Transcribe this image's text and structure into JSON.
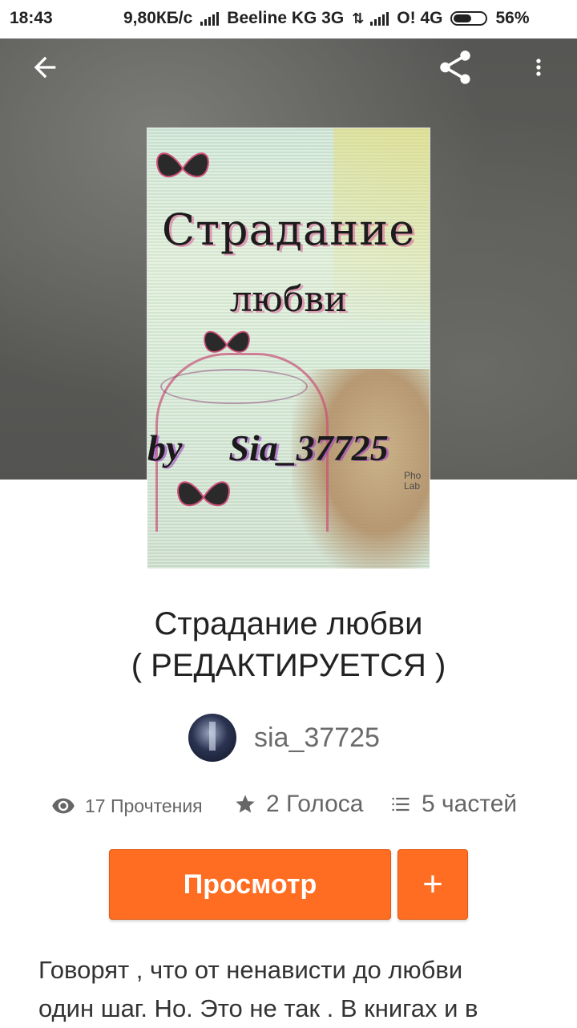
{
  "status_bar": {
    "time": "18:43",
    "network_speed": "9,80КБ/с",
    "carrier1": "Beeline KG 3G",
    "carrier2": "O! 4G",
    "battery": "56%"
  },
  "header": {
    "back_icon": "arrow-back-icon",
    "share_icon": "share-icon",
    "more_icon": "more-vert-icon"
  },
  "cover": {
    "title_line1": "Страдание",
    "title_line2": "любви",
    "by": "by",
    "author": "Sia_37725",
    "watermark": "Pho\nLab"
  },
  "story": {
    "title_line1": "Страдание любви",
    "title_line2": "( РЕДАКТИРУЕТСЯ )",
    "author": "sia_37725",
    "reads": "17 Прочтения",
    "votes": "2 Голоса",
    "parts": "5 частей",
    "description_line1": "Говорят , что от ненависти до любви",
    "description_line2": "один шаг. Но. Это не так . В книгах и в"
  },
  "actions": {
    "read_label": "Просмотр",
    "add_label": "+"
  },
  "colors": {
    "accent": "#ff6d22",
    "text": "#222222",
    "muted": "#666666"
  }
}
